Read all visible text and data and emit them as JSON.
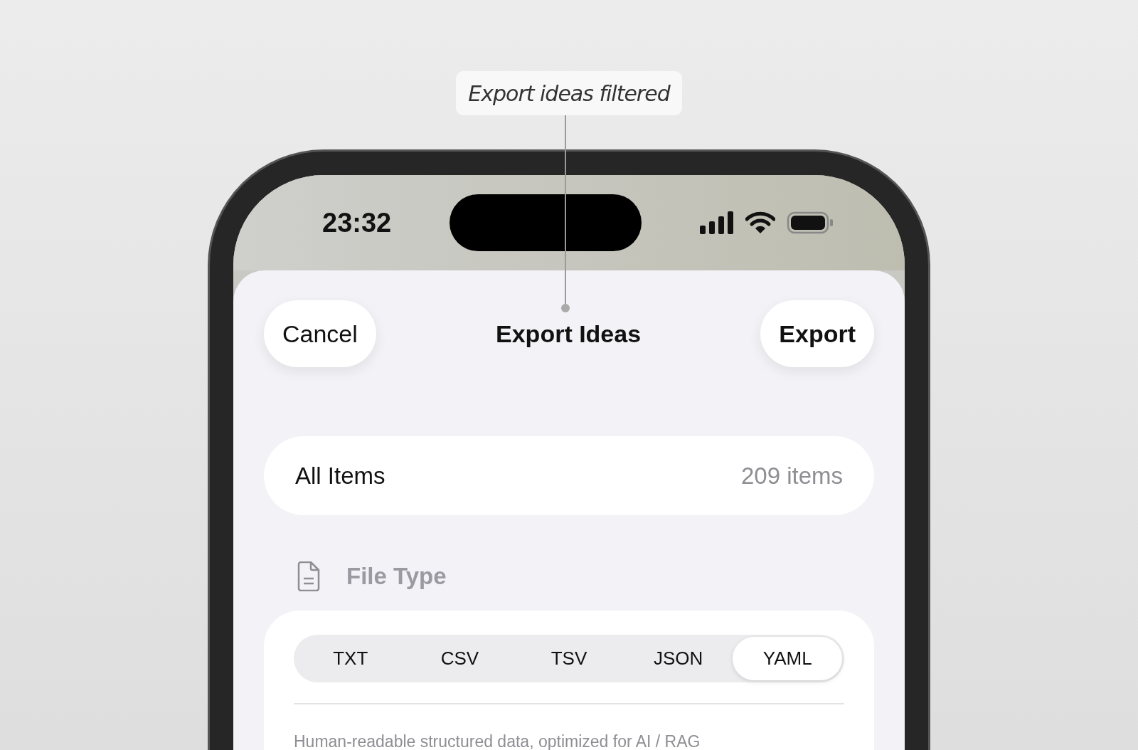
{
  "callout": {
    "text": "Export ideas filtered"
  },
  "status_bar": {
    "time": "23:32"
  },
  "nav": {
    "cancel": "Cancel",
    "title": "Export Ideas",
    "export": "Export"
  },
  "scope": {
    "label": "All Items",
    "count": "209 items"
  },
  "file_type": {
    "label": "File Type",
    "options": [
      {
        "label": "TXT",
        "selected": false
      },
      {
        "label": "CSV",
        "selected": false
      },
      {
        "label": "TSV",
        "selected": false
      },
      {
        "label": "JSON",
        "selected": false
      },
      {
        "label": "YAML",
        "selected": true
      }
    ],
    "description": "Human-readable structured data, optimized for AI / RAG"
  }
}
